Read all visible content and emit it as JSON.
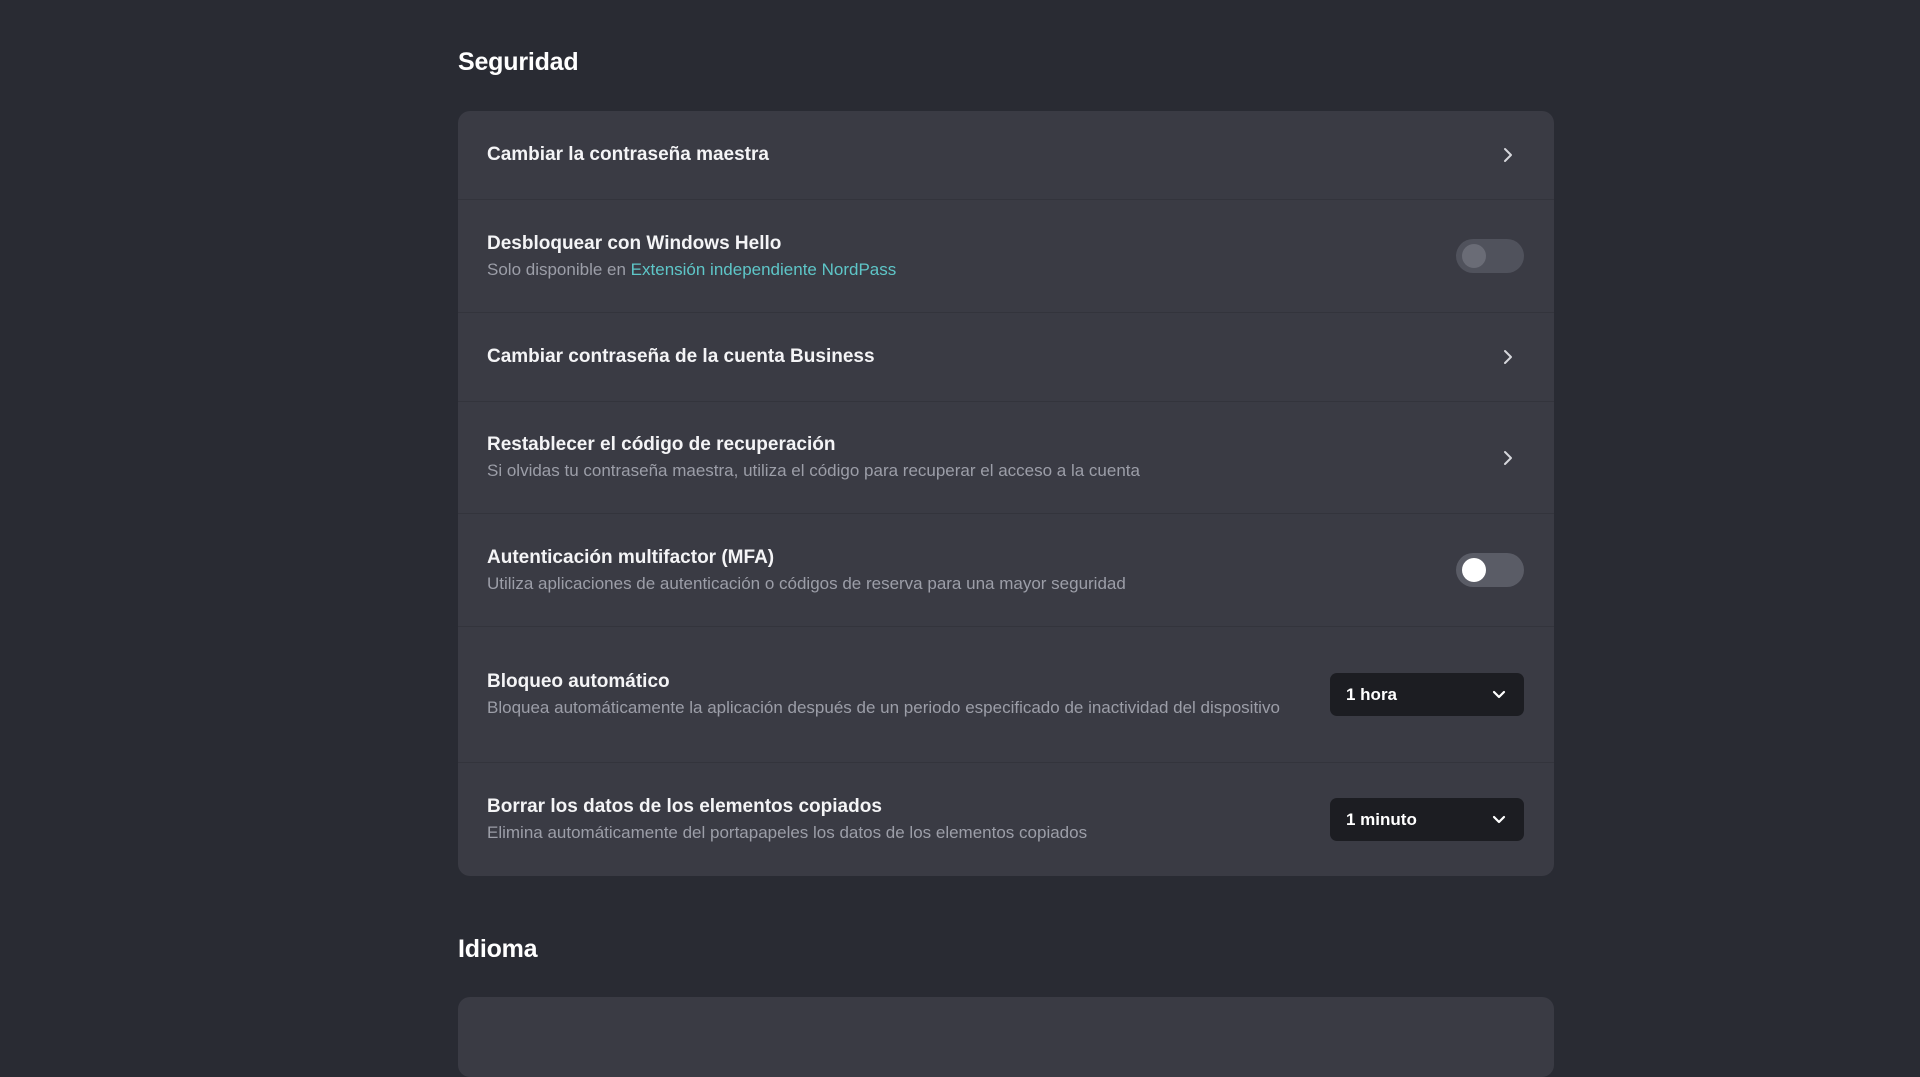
{
  "security": {
    "title": "Seguridad",
    "rows": [
      {
        "title": "Cambiar la contraseña maestra"
      },
      {
        "title": "Desbloquear con Windows Hello",
        "subtitle_prefix": "Solo disponible en ",
        "subtitle_link": "Extensión independiente NordPass",
        "toggle_on": false,
        "toggle_enabled": false
      },
      {
        "title": "Cambiar contraseña de la cuenta Business"
      },
      {
        "title": "Restablecer el código de recuperación",
        "subtitle": "Si olvidas tu contraseña maestra, utiliza el código para recuperar el acceso a la cuenta"
      },
      {
        "title": "Autenticación multifactor (MFA)",
        "subtitle": "Utiliza aplicaciones de autenticación o códigos de reserva para una mayor seguridad",
        "toggle_on": false,
        "toggle_enabled": true
      },
      {
        "title": "Bloqueo automático",
        "subtitle": "Bloquea automáticamente la aplicación después de un periodo especificado de inactividad del dispositivo",
        "select_value": "1 hora"
      },
      {
        "title": "Borrar los datos de los elementos copiados",
        "subtitle": "Elimina automáticamente del portapapeles los datos de los elementos copiados",
        "select_value": "1 minuto"
      }
    ]
  },
  "language": {
    "title": "Idioma"
  },
  "colors": {
    "background": "#292b33",
    "card": "#3a3b44",
    "link": "#5ec6c8",
    "select_bg": "#1c1d22"
  },
  "icons": {
    "chevron": "chevron-right-icon",
    "dropdown": "chevron-down-icon"
  }
}
